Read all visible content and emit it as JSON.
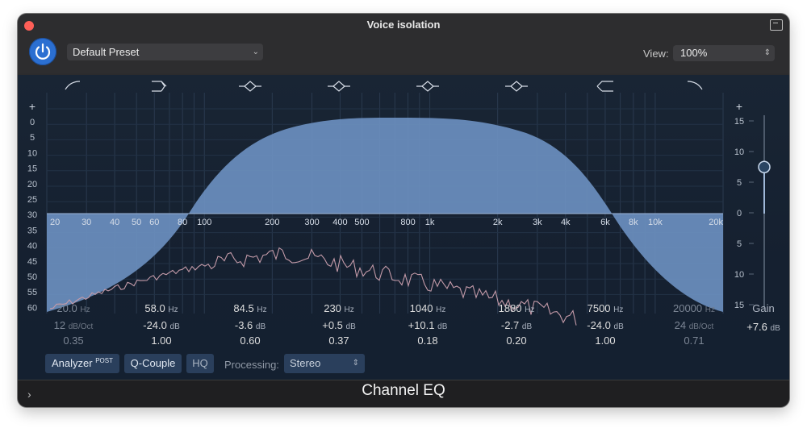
{
  "window": {
    "title": "Voice isolation",
    "footer_title": "Channel EQ"
  },
  "toolbar": {
    "preset": "Default Preset",
    "view_label": "View:",
    "view_value": "100%"
  },
  "left_scale": {
    "plus": "+",
    "ticks": [
      "0",
      "5",
      "10",
      "15",
      "20",
      "25",
      "30",
      "35",
      "40",
      "45",
      "50",
      "55",
      "60"
    ]
  },
  "right_scale": {
    "plus": "+",
    "ticks": [
      "15",
      "10",
      "5",
      "0",
      "5",
      "10",
      "15"
    ]
  },
  "freq_labels": [
    "20",
    "30",
    "40",
    "50",
    "60",
    "80",
    "100",
    "200",
    "300",
    "400",
    "500",
    "800",
    "1k",
    "2k",
    "3k",
    "4k",
    "6k",
    "8k",
    "10k",
    "20k"
  ],
  "band_icons": [
    "low-cut-icon",
    "low-shelf-icon",
    "bell-icon",
    "bell-icon",
    "bell-icon",
    "bell-icon",
    "high-shelf-icon",
    "high-cut-icon"
  ],
  "bands": [
    {
      "freq": "20.0",
      "freq_unit": "Hz",
      "gain": "12",
      "gain_unit": "dB/Oct",
      "q": "0.35",
      "enabled": false
    },
    {
      "freq": "58.0",
      "freq_unit": "Hz",
      "gain": "-24.0",
      "gain_unit": "dB",
      "q": "1.00",
      "enabled": true
    },
    {
      "freq": "84.5",
      "freq_unit": "Hz",
      "gain": "-3.6",
      "gain_unit": "dB",
      "q": "0.60",
      "enabled": true
    },
    {
      "freq": "230",
      "freq_unit": "Hz",
      "gain": "+0.5",
      "gain_unit": "dB",
      "q": "0.37",
      "enabled": true
    },
    {
      "freq": "1040",
      "freq_unit": "Hz",
      "gain": "+10.1",
      "gain_unit": "dB",
      "q": "0.18",
      "enabled": true
    },
    {
      "freq": "1880",
      "freq_unit": "Hz",
      "gain": "-2.7",
      "gain_unit": "dB",
      "q": "0.20",
      "enabled": true
    },
    {
      "freq": "7500",
      "freq_unit": "Hz",
      "gain": "-24.0",
      "gain_unit": "dB",
      "q": "1.00",
      "enabled": true
    },
    {
      "freq": "20000",
      "freq_unit": "Hz",
      "gain": "24",
      "gain_unit": "dB/Oct",
      "q": "0.71",
      "enabled": false
    }
  ],
  "gain": {
    "label": "Gain",
    "value": "+7.6",
    "unit": "dB",
    "level_db": 7.6
  },
  "controls": {
    "analyzer": "Analyzer",
    "analyzer_sup": "POST",
    "q_couple": "Q-Couple",
    "hq": "HQ",
    "processing_label": "Processing:",
    "processing_value": "Stereo"
  },
  "colors": {
    "accent": "#2b6fd1",
    "curve_fill": "#6b8fbf",
    "analyzer_line": "#c39aa8",
    "background": "#172333"
  }
}
